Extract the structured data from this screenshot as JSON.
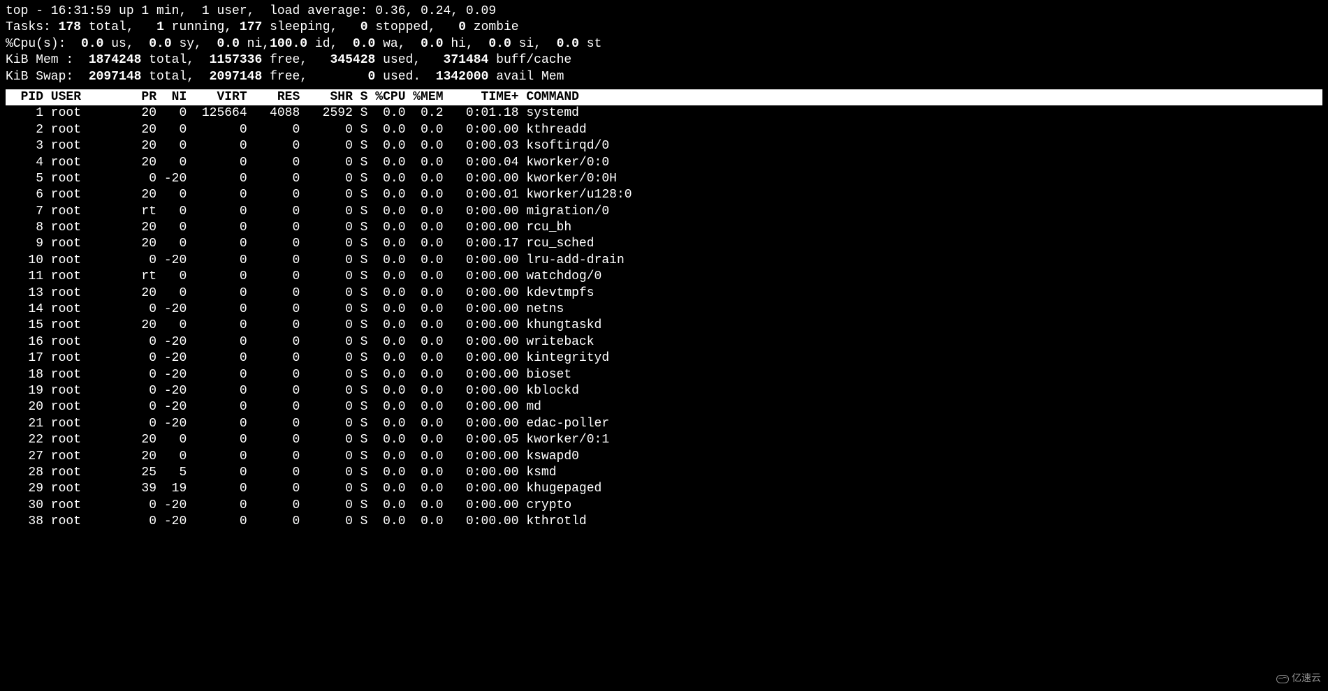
{
  "summary": {
    "line1_prefix": "top - 16:31:59 up 1 min,  1 user,  load average: 0.36, 0.24, 0.09",
    "line2_prefix": "Tasks: ",
    "tasks_total": "178",
    "tasks_total_lbl": " total,   ",
    "tasks_running": "1",
    "tasks_running_lbl": " running, ",
    "tasks_sleeping": "177",
    "tasks_sleeping_lbl": " sleeping,   ",
    "tasks_stopped": "0",
    "tasks_stopped_lbl": " stopped,   ",
    "tasks_zombie": "0",
    "tasks_zombie_lbl": " zombie",
    "line3_prefix": "%Cpu(s):  ",
    "cpu_us": "0.0",
    "cpu_us_lbl": " us,  ",
    "cpu_sy": "0.0",
    "cpu_sy_lbl": " sy,  ",
    "cpu_ni": "0.0",
    "cpu_ni_lbl": " ni,",
    "cpu_id": "100.0",
    "cpu_id_lbl": " id,  ",
    "cpu_wa": "0.0",
    "cpu_wa_lbl": " wa,  ",
    "cpu_hi": "0.0",
    "cpu_hi_lbl": " hi,  ",
    "cpu_si": "0.0",
    "cpu_si_lbl": " si,  ",
    "cpu_st": "0.0",
    "cpu_st_lbl": " st",
    "line4_prefix": "KiB Mem : ",
    "mem_total": " 1874248",
    "mem_total_lbl": " total,  ",
    "mem_free": "1157336",
    "mem_free_lbl": " free,   ",
    "mem_used": "345428",
    "mem_used_lbl": " used,   ",
    "mem_buff": "371484",
    "mem_buff_lbl": " buff/cache",
    "line5_prefix": "KiB Swap: ",
    "swap_total": " 2097148",
    "swap_total_lbl": " total,  ",
    "swap_free": "2097148",
    "swap_free_lbl": " free,        ",
    "swap_used": "0",
    "swap_used_lbl": " used.  ",
    "swap_avail": "1342000",
    "swap_avail_lbl": " avail Mem"
  },
  "columns": {
    "pid": "PID",
    "user": "USER",
    "pr": "PR",
    "ni": "NI",
    "virt": "VIRT",
    "res": "RES",
    "shr": "SHR",
    "s": "S",
    "cpu": "%CPU",
    "mem": "%MEM",
    "time": "TIME+",
    "command": "COMMAND"
  },
  "processes": [
    {
      "pid": "1",
      "user": "root",
      "pr": "20",
      "ni": "0",
      "virt": "125664",
      "res": "4088",
      "shr": "2592",
      "s": "S",
      "cpu": "0.0",
      "mem": "0.2",
      "time": "0:01.18",
      "command": "systemd"
    },
    {
      "pid": "2",
      "user": "root",
      "pr": "20",
      "ni": "0",
      "virt": "0",
      "res": "0",
      "shr": "0",
      "s": "S",
      "cpu": "0.0",
      "mem": "0.0",
      "time": "0:00.00",
      "command": "kthreadd"
    },
    {
      "pid": "3",
      "user": "root",
      "pr": "20",
      "ni": "0",
      "virt": "0",
      "res": "0",
      "shr": "0",
      "s": "S",
      "cpu": "0.0",
      "mem": "0.0",
      "time": "0:00.03",
      "command": "ksoftirqd/0"
    },
    {
      "pid": "4",
      "user": "root",
      "pr": "20",
      "ni": "0",
      "virt": "0",
      "res": "0",
      "shr": "0",
      "s": "S",
      "cpu": "0.0",
      "mem": "0.0",
      "time": "0:00.04",
      "command": "kworker/0:0"
    },
    {
      "pid": "5",
      "user": "root",
      "pr": "0",
      "ni": "-20",
      "virt": "0",
      "res": "0",
      "shr": "0",
      "s": "S",
      "cpu": "0.0",
      "mem": "0.0",
      "time": "0:00.00",
      "command": "kworker/0:0H"
    },
    {
      "pid": "6",
      "user": "root",
      "pr": "20",
      "ni": "0",
      "virt": "0",
      "res": "0",
      "shr": "0",
      "s": "S",
      "cpu": "0.0",
      "mem": "0.0",
      "time": "0:00.01",
      "command": "kworker/u128:0"
    },
    {
      "pid": "7",
      "user": "root",
      "pr": "rt",
      "ni": "0",
      "virt": "0",
      "res": "0",
      "shr": "0",
      "s": "S",
      "cpu": "0.0",
      "mem": "0.0",
      "time": "0:00.00",
      "command": "migration/0"
    },
    {
      "pid": "8",
      "user": "root",
      "pr": "20",
      "ni": "0",
      "virt": "0",
      "res": "0",
      "shr": "0",
      "s": "S",
      "cpu": "0.0",
      "mem": "0.0",
      "time": "0:00.00",
      "command": "rcu_bh"
    },
    {
      "pid": "9",
      "user": "root",
      "pr": "20",
      "ni": "0",
      "virt": "0",
      "res": "0",
      "shr": "0",
      "s": "S",
      "cpu": "0.0",
      "mem": "0.0",
      "time": "0:00.17",
      "command": "rcu_sched"
    },
    {
      "pid": "10",
      "user": "root",
      "pr": "0",
      "ni": "-20",
      "virt": "0",
      "res": "0",
      "shr": "0",
      "s": "S",
      "cpu": "0.0",
      "mem": "0.0",
      "time": "0:00.00",
      "command": "lru-add-drain"
    },
    {
      "pid": "11",
      "user": "root",
      "pr": "rt",
      "ni": "0",
      "virt": "0",
      "res": "0",
      "shr": "0",
      "s": "S",
      "cpu": "0.0",
      "mem": "0.0",
      "time": "0:00.00",
      "command": "watchdog/0"
    },
    {
      "pid": "13",
      "user": "root",
      "pr": "20",
      "ni": "0",
      "virt": "0",
      "res": "0",
      "shr": "0",
      "s": "S",
      "cpu": "0.0",
      "mem": "0.0",
      "time": "0:00.00",
      "command": "kdevtmpfs"
    },
    {
      "pid": "14",
      "user": "root",
      "pr": "0",
      "ni": "-20",
      "virt": "0",
      "res": "0",
      "shr": "0",
      "s": "S",
      "cpu": "0.0",
      "mem": "0.0",
      "time": "0:00.00",
      "command": "netns"
    },
    {
      "pid": "15",
      "user": "root",
      "pr": "20",
      "ni": "0",
      "virt": "0",
      "res": "0",
      "shr": "0",
      "s": "S",
      "cpu": "0.0",
      "mem": "0.0",
      "time": "0:00.00",
      "command": "khungtaskd"
    },
    {
      "pid": "16",
      "user": "root",
      "pr": "0",
      "ni": "-20",
      "virt": "0",
      "res": "0",
      "shr": "0",
      "s": "S",
      "cpu": "0.0",
      "mem": "0.0",
      "time": "0:00.00",
      "command": "writeback"
    },
    {
      "pid": "17",
      "user": "root",
      "pr": "0",
      "ni": "-20",
      "virt": "0",
      "res": "0",
      "shr": "0",
      "s": "S",
      "cpu": "0.0",
      "mem": "0.0",
      "time": "0:00.00",
      "command": "kintegrityd"
    },
    {
      "pid": "18",
      "user": "root",
      "pr": "0",
      "ni": "-20",
      "virt": "0",
      "res": "0",
      "shr": "0",
      "s": "S",
      "cpu": "0.0",
      "mem": "0.0",
      "time": "0:00.00",
      "command": "bioset"
    },
    {
      "pid": "19",
      "user": "root",
      "pr": "0",
      "ni": "-20",
      "virt": "0",
      "res": "0",
      "shr": "0",
      "s": "S",
      "cpu": "0.0",
      "mem": "0.0",
      "time": "0:00.00",
      "command": "kblockd"
    },
    {
      "pid": "20",
      "user": "root",
      "pr": "0",
      "ni": "-20",
      "virt": "0",
      "res": "0",
      "shr": "0",
      "s": "S",
      "cpu": "0.0",
      "mem": "0.0",
      "time": "0:00.00",
      "command": "md"
    },
    {
      "pid": "21",
      "user": "root",
      "pr": "0",
      "ni": "-20",
      "virt": "0",
      "res": "0",
      "shr": "0",
      "s": "S",
      "cpu": "0.0",
      "mem": "0.0",
      "time": "0:00.00",
      "command": "edac-poller"
    },
    {
      "pid": "22",
      "user": "root",
      "pr": "20",
      "ni": "0",
      "virt": "0",
      "res": "0",
      "shr": "0",
      "s": "S",
      "cpu": "0.0",
      "mem": "0.0",
      "time": "0:00.05",
      "command": "kworker/0:1"
    },
    {
      "pid": "27",
      "user": "root",
      "pr": "20",
      "ni": "0",
      "virt": "0",
      "res": "0",
      "shr": "0",
      "s": "S",
      "cpu": "0.0",
      "mem": "0.0",
      "time": "0:00.00",
      "command": "kswapd0"
    },
    {
      "pid": "28",
      "user": "root",
      "pr": "25",
      "ni": "5",
      "virt": "0",
      "res": "0",
      "shr": "0",
      "s": "S",
      "cpu": "0.0",
      "mem": "0.0",
      "time": "0:00.00",
      "command": "ksmd"
    },
    {
      "pid": "29",
      "user": "root",
      "pr": "39",
      "ni": "19",
      "virt": "0",
      "res": "0",
      "shr": "0",
      "s": "S",
      "cpu": "0.0",
      "mem": "0.0",
      "time": "0:00.00",
      "command": "khugepaged"
    },
    {
      "pid": "30",
      "user": "root",
      "pr": "0",
      "ni": "-20",
      "virt": "0",
      "res": "0",
      "shr": "0",
      "s": "S",
      "cpu": "0.0",
      "mem": "0.0",
      "time": "0:00.00",
      "command": "crypto"
    },
    {
      "pid": "38",
      "user": "root",
      "pr": "0",
      "ni": "-20",
      "virt": "0",
      "res": "0",
      "shr": "0",
      "s": "S",
      "cpu": "0.0",
      "mem": "0.0",
      "time": "0:00.00",
      "command": "kthrotld"
    }
  ],
  "watermark": "亿速云"
}
